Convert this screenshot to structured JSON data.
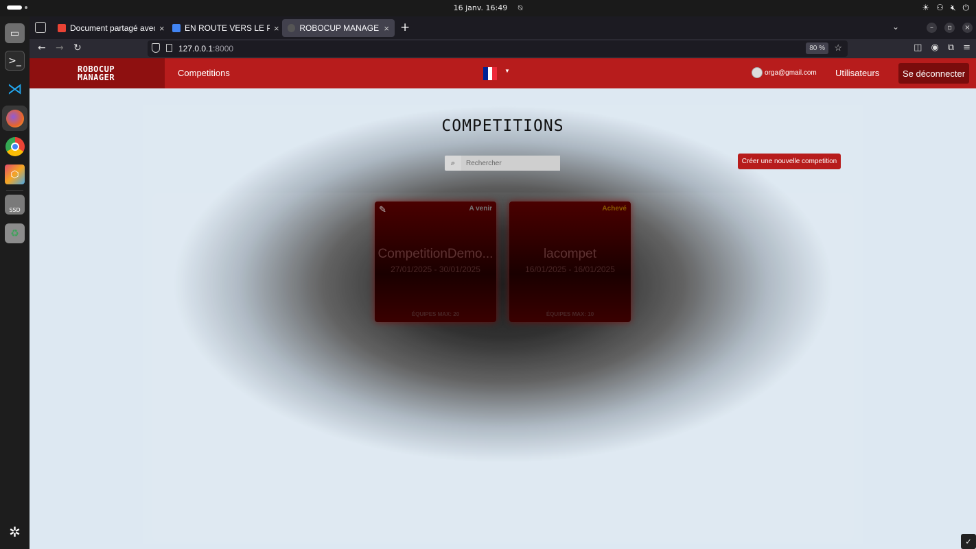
{
  "os": {
    "clock": "16 janv.  16:49",
    "tray_icons": [
      "brightness-icon",
      "network-icon",
      "volume-mute-icon",
      "power-icon"
    ]
  },
  "dock": {
    "apps": [
      "files-icon",
      "terminal-icon",
      "vscode-icon",
      "firefox-icon",
      "chrome-icon",
      "box-icon",
      "ssd-icon",
      "trash-icon",
      "ubuntu-apps-icon"
    ],
    "ssd_label": "SSD"
  },
  "browser": {
    "tabs": [
      {
        "title": "Document partagé avec vous",
        "favicon_color": "#ea4335"
      },
      {
        "title": "EN ROUTE VERS LE PROCHAIN",
        "favicon_color": "#4285f4"
      },
      {
        "title": "ROBOCUP MANAGER",
        "favicon_color": "#555555"
      }
    ],
    "url_host": "127.0.0.1",
    "url_port": ":8000",
    "zoom": "80 %"
  },
  "app": {
    "brand_line1": "ROBOCUP",
    "brand_line2": "MANAGER",
    "nav_competitions": "Competitions",
    "user_email": "orga@gmail.com",
    "nav_users": "Utilisateurs",
    "logout": "Se déconnecter",
    "accent": "#b71c1c"
  },
  "main": {
    "title": "COMPETITIONS",
    "search_placeholder": "Rechercher",
    "create_button": "Créer une nouvelle competition",
    "cards": [
      {
        "status": "A venir",
        "status_color": "#777777",
        "name": "CompetitionDemo...",
        "dates": "27/01/2025 - 30/01/2025",
        "teams": "ÉQUIPES MAX: 20"
      },
      {
        "status": "Achevé",
        "status_color": "#8a5a00",
        "name": "lacompet",
        "dates": "16/01/2025 - 16/01/2025",
        "teams": "ÉQUIPES MAX: 10"
      }
    ]
  }
}
